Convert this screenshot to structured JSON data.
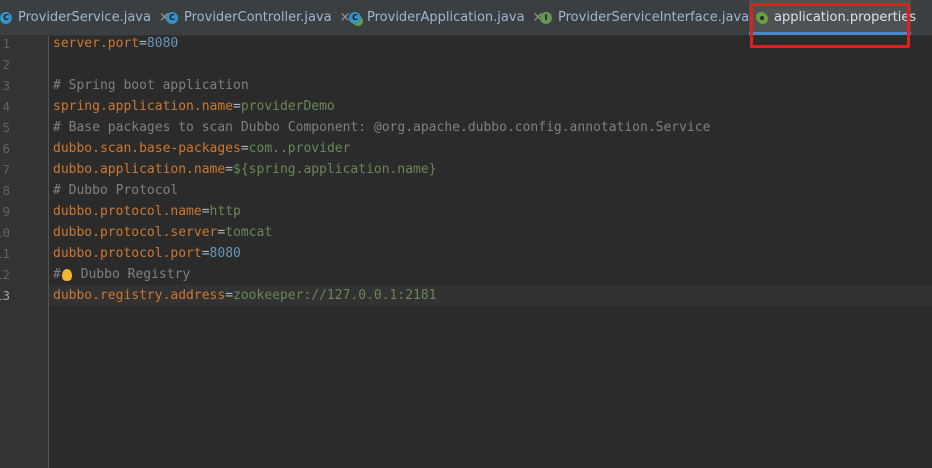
{
  "tabs": [
    {
      "label": "ProviderService.java",
      "icon": "class-icon",
      "icon_letter": "C",
      "icon_color": "#3592c4"
    },
    {
      "label": "ProviderController.java",
      "icon": "class-icon",
      "icon_letter": "C",
      "icon_color": "#3592c4"
    },
    {
      "label": "ProviderApplication.java",
      "icon": "spring-boot-class-icon",
      "icon_letter": "C",
      "icon_color": "#3592c4"
    },
    {
      "label": "ProviderServiceInterface.java",
      "icon": "interface-icon",
      "icon_letter": "I",
      "icon_color": "#629755"
    },
    {
      "label": "application.properties",
      "icon": "spring-properties-icon",
      "icon_letter": "",
      "icon_color": "#6a9f3a",
      "active": true
    }
  ],
  "close_glyph": "×",
  "line_numbers": [
    "1",
    "2",
    "3",
    "4",
    "5",
    "6",
    "7",
    "8",
    "9",
    "10",
    "11",
    "12",
    "13"
  ],
  "current_line": "13",
  "lines": {
    "l1": {
      "key": "server.port",
      "eq": "=",
      "val": "8080"
    },
    "l3": {
      "comment": "# Spring boot application"
    },
    "l4": {
      "key": "spring.application.name",
      "eq": "=",
      "val": "providerDemo"
    },
    "l5": {
      "comment": "# Base packages to scan Dubbo Component: @org.apache.dubbo.config.annotation.Service"
    },
    "l6": {
      "key": "dubbo.scan.base-packages",
      "eq": "=",
      "val": "com..provider"
    },
    "l7": {
      "key": "dubbo.application.name",
      "eq": "=",
      "val": "${spring.application.name}"
    },
    "l8": {
      "comment": "# Dubbo Protocol"
    },
    "l9": {
      "key": "dubbo.protocol.name",
      "eq": "=",
      "val": "http"
    },
    "l10": {
      "key": "dubbo.protocol.server",
      "eq": "=",
      "val": "tomcat"
    },
    "l11": {
      "key": "dubbo.protocol.port",
      "eq": "=",
      "val": "8080"
    },
    "l12": {
      "comment_prefix": "#",
      "comment_rest": " Dubbo Registry"
    },
    "l13": {
      "key": "dubbo.registry.address",
      "eq": "=",
      "val": "zookeeper://127.0.0.1:2181"
    }
  },
  "colors": {
    "key": "#cc7832",
    "value": "#6a8759",
    "number": "#6897bb",
    "comment": "#808080",
    "highlight_box": "#e01f1f",
    "active_tab_underline": "#4a88c7"
  }
}
